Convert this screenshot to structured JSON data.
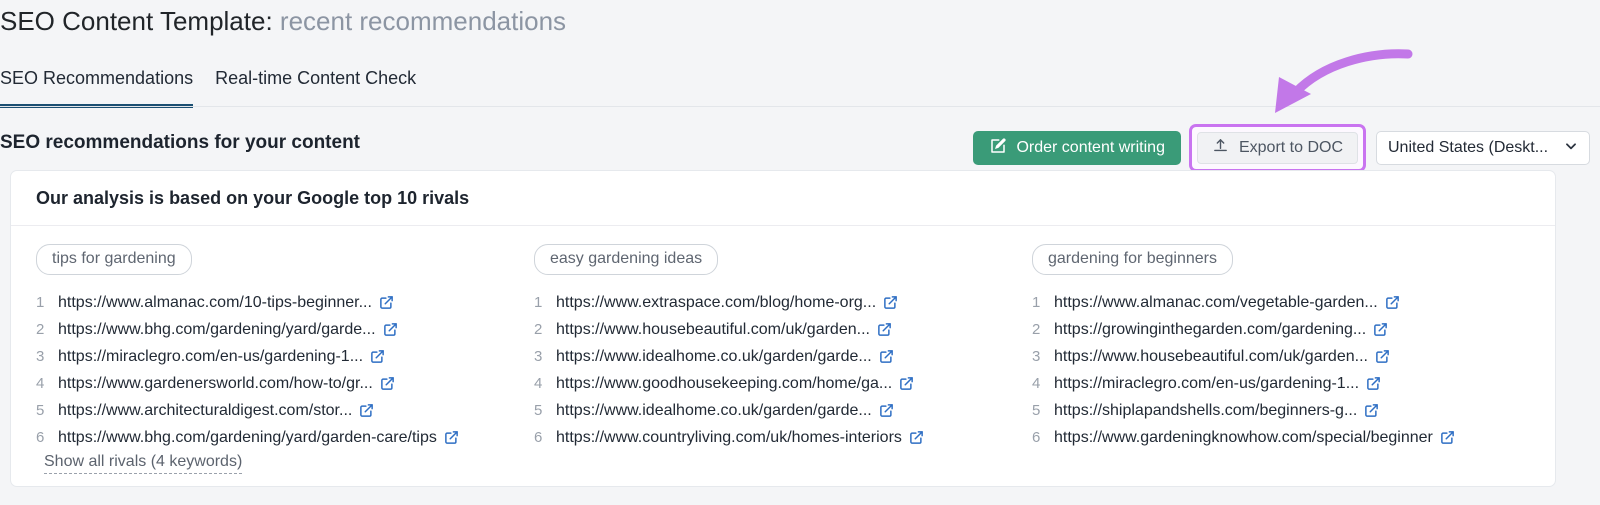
{
  "header": {
    "title_main": "SEO Content Template:",
    "title_sub": "recent recommendations"
  },
  "tabs": [
    {
      "label": "SEO Recommendations",
      "active": true
    },
    {
      "label": "Real-time Content Check",
      "active": false
    }
  ],
  "toolbar": {
    "heading": "SEO recommendations for your content",
    "order_label": "Order content writing",
    "order_icon": "pencil-square-icon",
    "export_label": "Export to DOC",
    "export_icon": "upload-icon",
    "region_value": "United States (Deskt...",
    "region_icon": "chevron-down-icon",
    "highlight_color": "#c974f0",
    "order_color": "#3a9b78",
    "active_tab_color": "#1b4f72"
  },
  "card": {
    "heading": "Our analysis is based on your Google top 10 rivals",
    "show_all_label": "Show all rivals (4 keywords)",
    "link_icon": "external-link-icon",
    "link_icon_color": "#2f6fc4",
    "columns": [
      {
        "keyword": "tips for gardening",
        "rivals": [
          {
            "rank": "1",
            "url": "https://www.almanac.com/10-tips-beginner..."
          },
          {
            "rank": "2",
            "url": "https://www.bhg.com/gardening/yard/garde..."
          },
          {
            "rank": "3",
            "url": "https://miraclegro.com/en-us/gardening-1..."
          },
          {
            "rank": "4",
            "url": "https://www.gardenersworld.com/how-to/gr..."
          },
          {
            "rank": "5",
            "url": "https://www.architecturaldigest.com/stor..."
          },
          {
            "rank": "6",
            "url": "https://www.bhg.com/gardening/yard/garden-care/tips"
          }
        ]
      },
      {
        "keyword": "easy gardening ideas",
        "rivals": [
          {
            "rank": "1",
            "url": "https://www.extraspace.com/blog/home-org..."
          },
          {
            "rank": "2",
            "url": "https://www.housebeautiful.com/uk/garden..."
          },
          {
            "rank": "3",
            "url": "https://www.idealhome.co.uk/garden/garde..."
          },
          {
            "rank": "4",
            "url": "https://www.goodhousekeeping.com/home/ga..."
          },
          {
            "rank": "5",
            "url": "https://www.idealhome.co.uk/garden/garde..."
          },
          {
            "rank": "6",
            "url": "https://www.countryliving.com/uk/homes-interiors"
          }
        ]
      },
      {
        "keyword": "gardening for beginners",
        "rivals": [
          {
            "rank": "1",
            "url": "https://www.almanac.com/vegetable-garden..."
          },
          {
            "rank": "2",
            "url": "https://growinginthegarden.com/gardening..."
          },
          {
            "rank": "3",
            "url": "https://www.housebeautiful.com/uk/garden..."
          },
          {
            "rank": "4",
            "url": "https://miraclegro.com/en-us/gardening-1..."
          },
          {
            "rank": "5",
            "url": "https://shiplapandshells.com/beginners-g..."
          },
          {
            "rank": "6",
            "url": "https://www.gardeningknowhow.com/special/beginner"
          }
        ]
      }
    ]
  },
  "annotation": {
    "arrow_icon": "curved-arrow-icon",
    "arrow_color": "#c278e8"
  }
}
